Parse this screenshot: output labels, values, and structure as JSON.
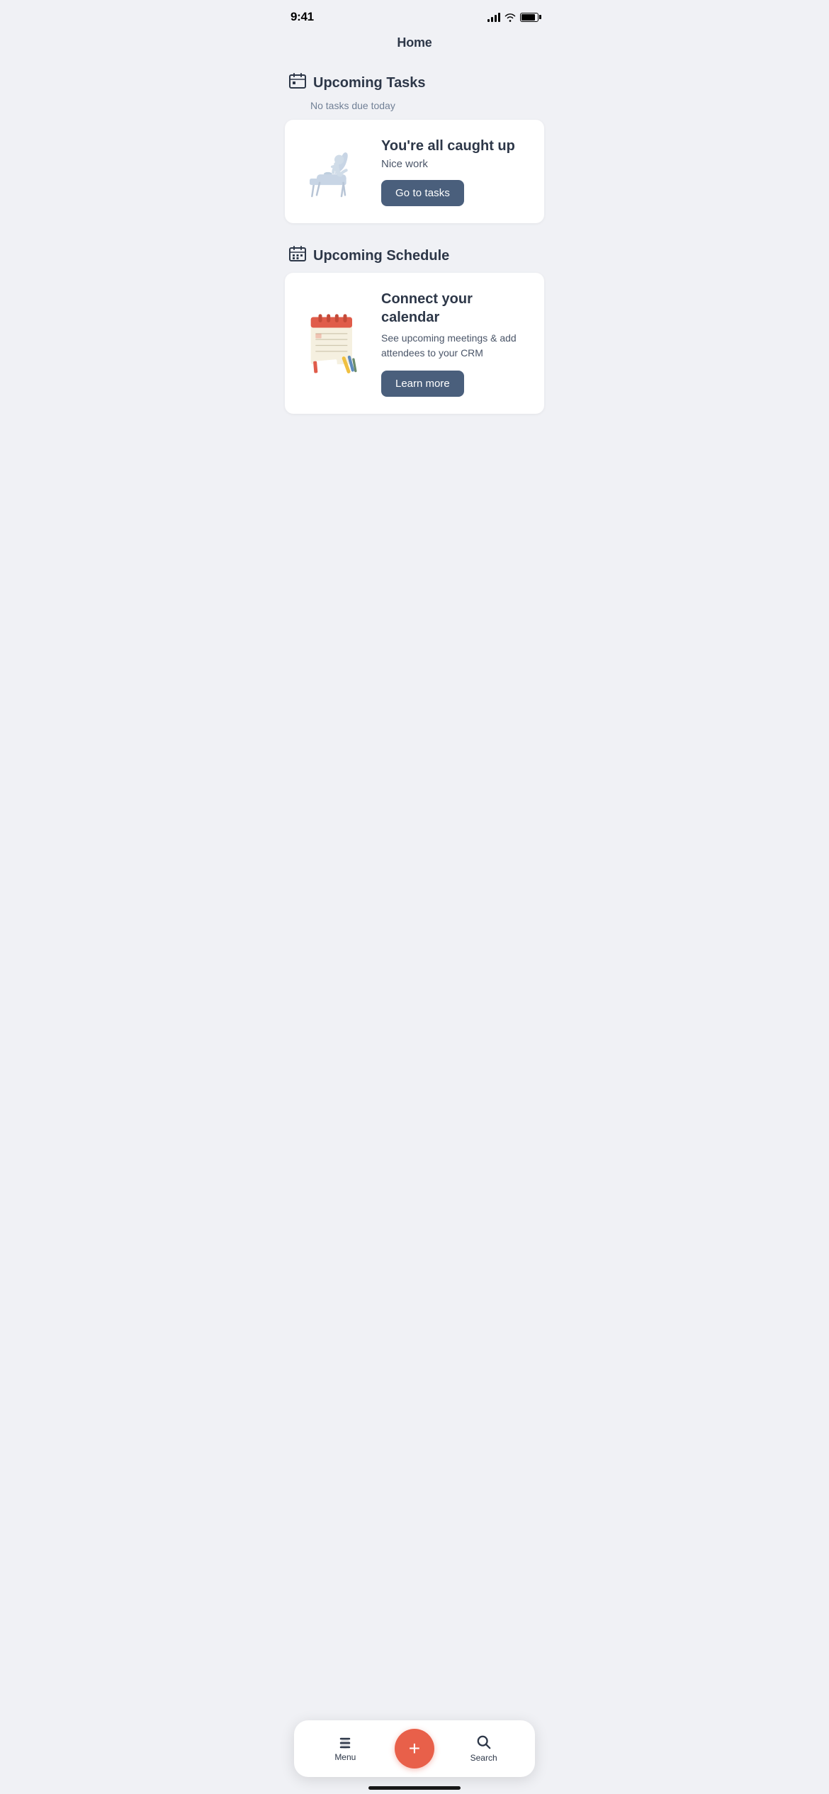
{
  "statusBar": {
    "time": "9:41"
  },
  "pageTitle": "Home",
  "upcomingTasks": {
    "title": "Upcoming Tasks",
    "subtitle": "No tasks due today",
    "caughtUpTitle": "You're all caught up",
    "caughtUpSubtitle": "Nice work",
    "goToTasksLabel": "Go to tasks"
  },
  "upcomingSchedule": {
    "title": "Upcoming Schedule",
    "calendarTitle": "Connect your calendar",
    "calendarSubtitle": "See upcoming meetings & add attendees to your CRM",
    "learnMoreLabel": "Learn more"
  },
  "tabBar": {
    "menuLabel": "Menu",
    "searchLabel": "Search"
  }
}
